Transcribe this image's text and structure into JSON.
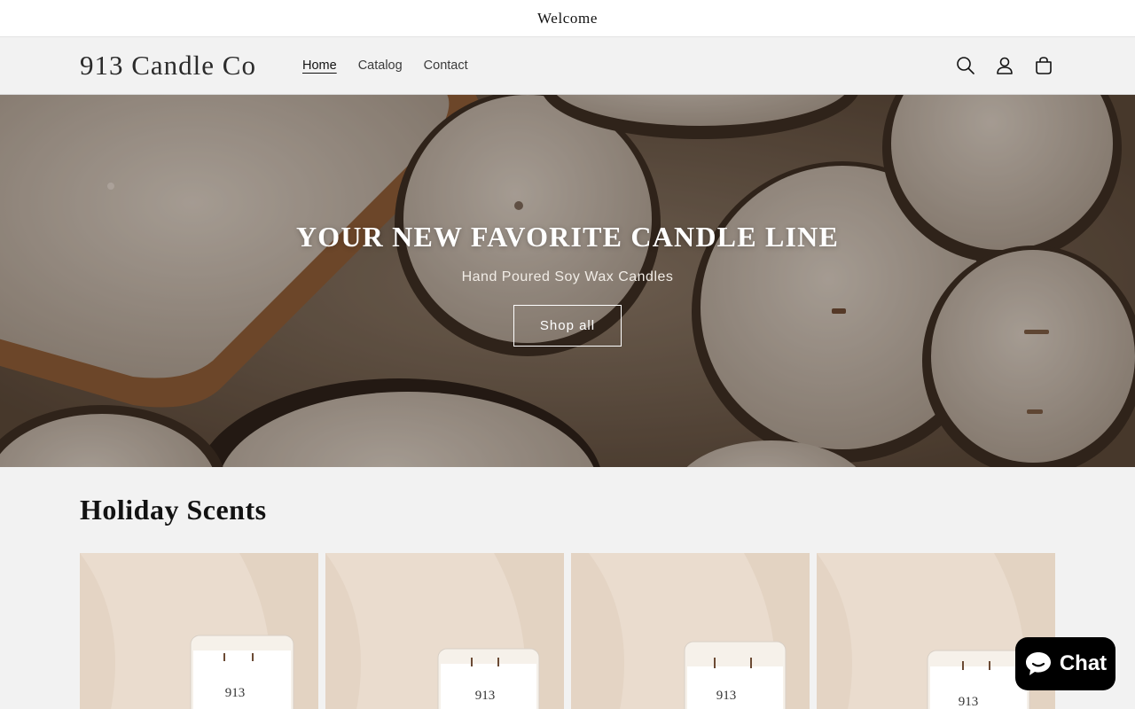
{
  "announcement": {
    "text": "Welcome"
  },
  "header": {
    "logo": "913 Candle Co",
    "nav": [
      {
        "label": "Home",
        "active": true
      },
      {
        "label": "Catalog",
        "active": false
      },
      {
        "label": "Contact",
        "active": false
      }
    ],
    "icons": [
      "search-icon",
      "account-icon",
      "cart-icon"
    ]
  },
  "hero": {
    "title": "YOUR NEW FAVORITE CANDLE LINE",
    "subtitle": "Hand Poured Soy Wax Candles",
    "button_label": "Shop all"
  },
  "collection": {
    "title": "Holiday Scents",
    "products": [
      {
        "jar_label": "913"
      },
      {
        "jar_label": "913"
      },
      {
        "jar_label": "913"
      },
      {
        "jar_label": "913"
      }
    ]
  },
  "chat": {
    "label": "Chat",
    "icon": "chat-bubble-icon"
  },
  "colors": {
    "background": "#f2f2f2",
    "chat_button": "#000000",
    "hero_overlay": "#6e5a48"
  }
}
